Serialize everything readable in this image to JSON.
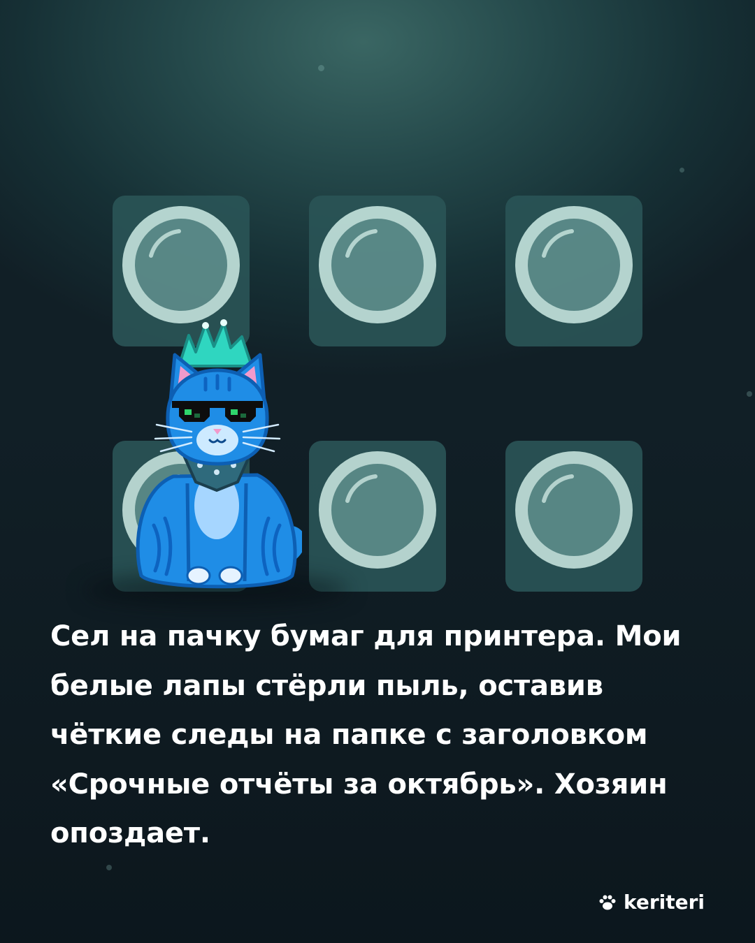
{
  "caption": "Сел на пачку бумаг для принтера. Мои белые лапы стёрли пыль, оставив чёткие следы на папке с заголовком «Срочные отчёты за октябрь». Хозяин опоздает.",
  "brand": {
    "name": "keriteri",
    "icon": "paw-icon"
  },
  "colors": {
    "background": "#1a343a",
    "tile": "#2a5456",
    "button_ring": "#c2e2dc",
    "button_fill": "#5e8f8d",
    "cat_body": "#1f8de6",
    "mohawk": "#2fd6c0",
    "text": "#ffffff"
  }
}
